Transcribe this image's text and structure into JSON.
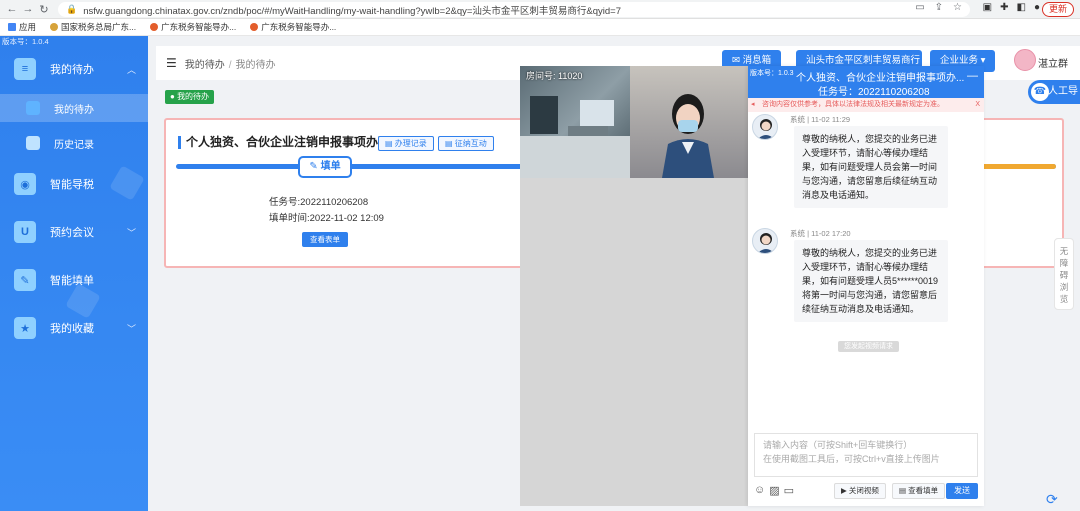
{
  "browser": {
    "url": "nsfw.guangdong.chinatax.gov.cn/zndb/poc/#/myWaitHandling/my-wait-handling?ywlb=2&qy=汕头市金平区刺丰贸易商行&qyid=7",
    "update_label": "更新",
    "bookmarks": [
      "应用",
      "国家税务总局广东...",
      "广东税务智能导办...",
      "广东税务智能导办..."
    ]
  },
  "sidebar": {
    "version": "版本号：1.0.4",
    "menu_my_todo": "我的待办",
    "sub_my_todo": "我的待办",
    "sub_history": "历史记录",
    "menu_smart_guide": "智能导税",
    "menu_appointment": "预约会议",
    "menu_smart_form": "智能填单",
    "menu_favorites": "我的收藏"
  },
  "header": {
    "crumb_root": "我的待办",
    "crumb_sep": "/",
    "crumb_current": "我的待办",
    "btn_message": "消息箱",
    "btn_company": "汕头市金平区刺丰贸易商行",
    "btn_enterprise": "企业业务",
    "username": "湛立群"
  },
  "tag": "我的待办",
  "card": {
    "title": "个人独资、合伙企业注销申报事项办理",
    "btn_record": "办理记录",
    "btn_interact": "征纳互动",
    "step_label": "填单",
    "task_no": "任务号:2022110206208",
    "fill_time": "填单时间:2022-11-02 12:09",
    "view_form": "查看表单"
  },
  "video": {
    "room_label": "房间号: 11020"
  },
  "chat": {
    "version": "版本号：1.0.3",
    "title": "个人独资、合伙企业注销申报事项办...",
    "task_no": "任务号：2022110206208",
    "warning": "咨询内容仅供参考，具体以法律法规及相关最新规定为准。",
    "close_x": "X",
    "messages": [
      {
        "meta": "系统 | 11-02 11:29",
        "text": "尊敬的纳税人，您提交的业务已进入受理环节，请耐心等候办理结果，如有问题受理人员会第一时间与您沟通，请您留意后续征纳互动消息及电话通知。"
      },
      {
        "meta": "系统 | 11-02 17:20",
        "text": "尊敬的纳税人，您提交的业务已进入受理环节，请耐心等候办理结果，如有问题受理人员5******0019将第一时间与您沟通，请您留意后续征纳互动消息及电话通知。"
      }
    ],
    "system_note": "您发起视频请求",
    "input_placeholder_1": "请输入内容（可按Shift+回车键换行）",
    "input_placeholder_2": "在使用截图工具后，可按Ctrl+v直接上传图片",
    "btn_close_video": "关闭视频",
    "btn_view_form": "查看填单",
    "btn_send": "发送"
  },
  "right_rail": {
    "ai_guide": "人工导",
    "a11y": [
      "无",
      "障",
      "碍",
      "浏",
      "览"
    ]
  }
}
